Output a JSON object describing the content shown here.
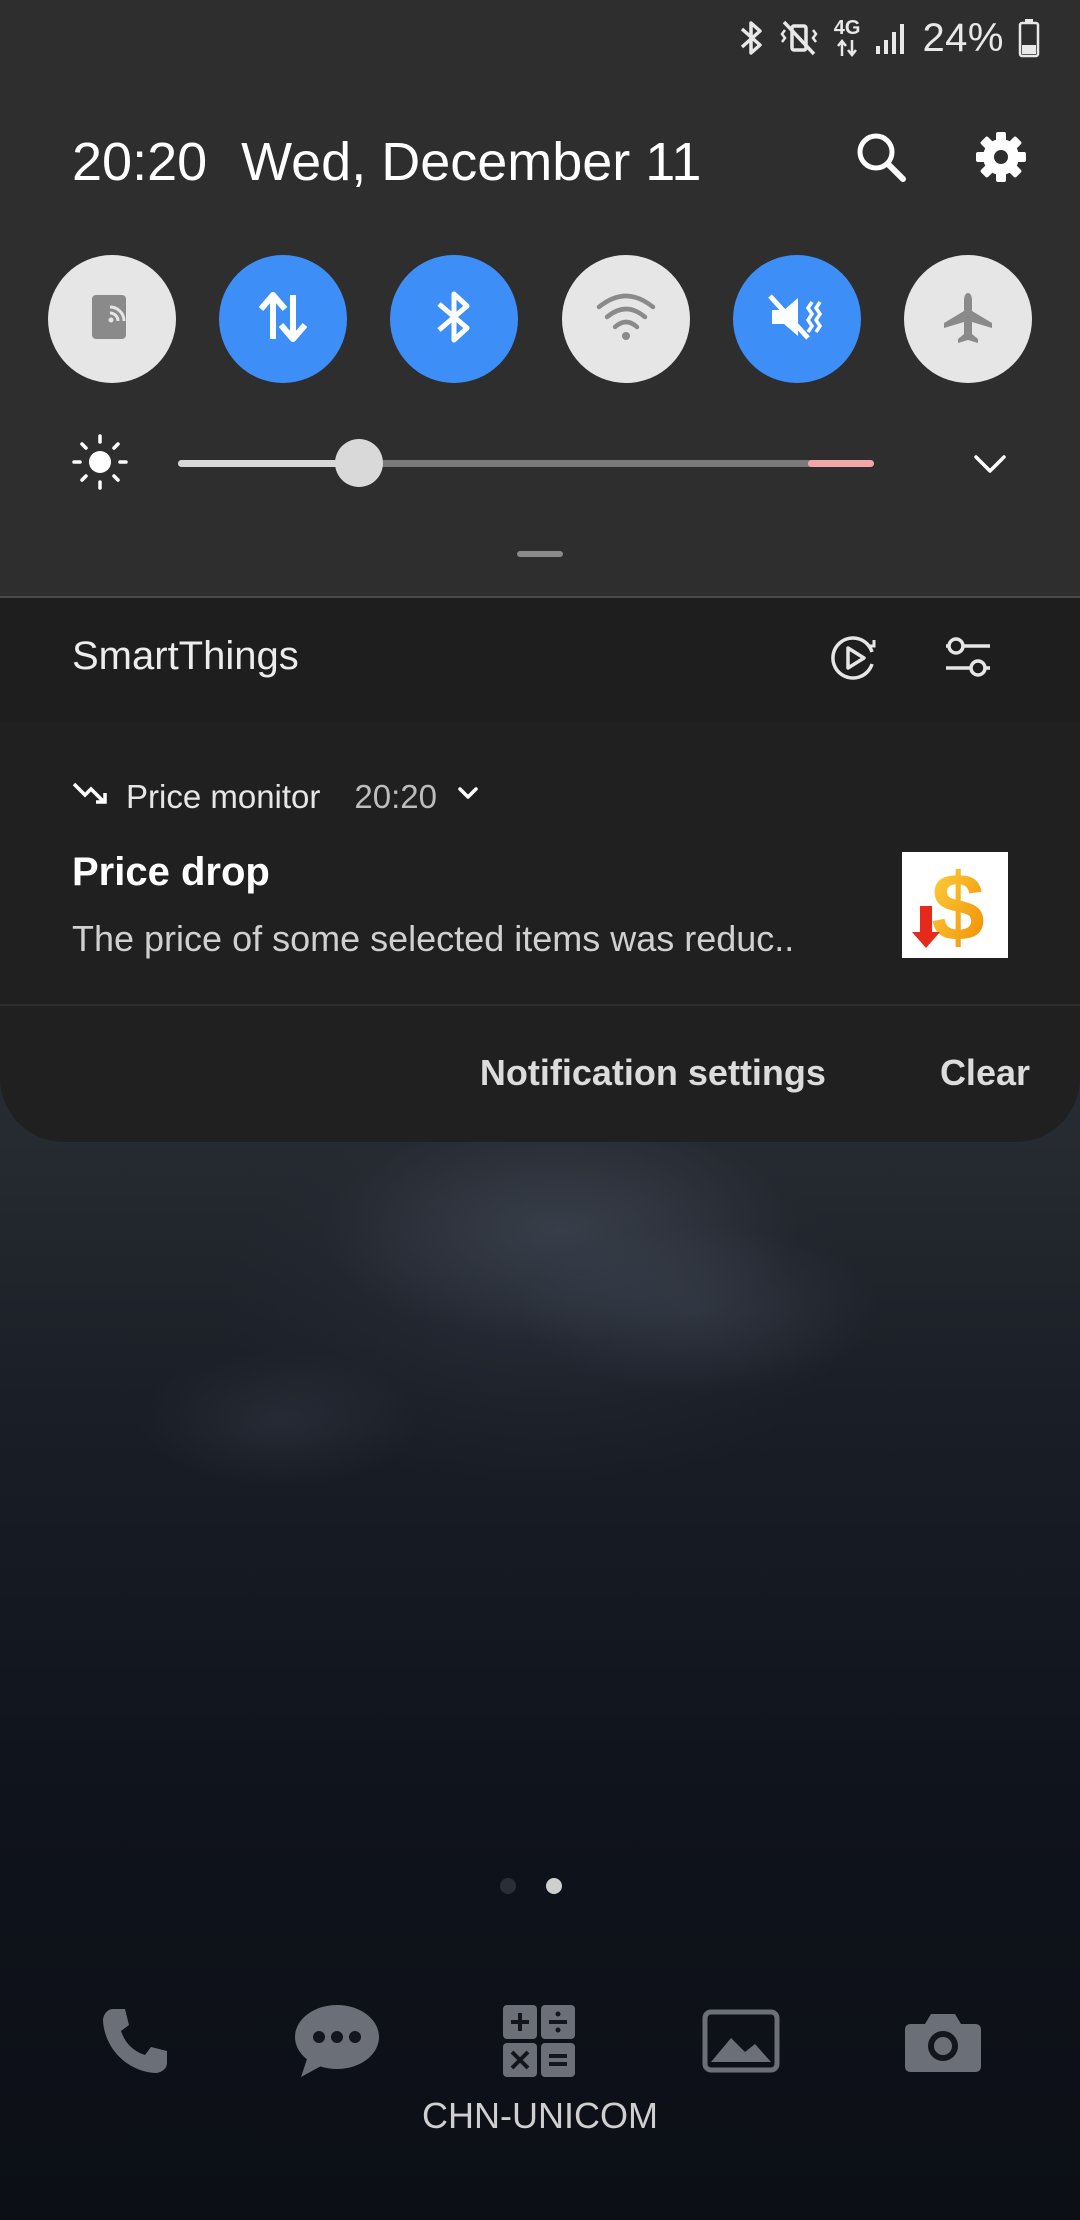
{
  "status_bar": {
    "icons": [
      "bluetooth-icon",
      "vibrate-mute-icon",
      "4g-data-icon",
      "signal-icon",
      "battery-icon"
    ],
    "network_label": "4G",
    "battery_percent": "24%"
  },
  "panel": {
    "time": "20:20",
    "date": "Wed, December 11",
    "header_icons": [
      "search-icon",
      "settings-gear-icon"
    ]
  },
  "quick_settings": [
    {
      "name": "Smart View",
      "icon": "cast-icon",
      "state": "off"
    },
    {
      "name": "Mobile data",
      "icon": "mobile-data-icon",
      "state": "on"
    },
    {
      "name": "Bluetooth",
      "icon": "bluetooth-icon",
      "state": "on"
    },
    {
      "name": "Wi-Fi",
      "icon": "wifi-icon",
      "state": "off"
    },
    {
      "name": "Sound",
      "icon": "vibrate-icon",
      "state": "on"
    },
    {
      "name": "Airplane mode",
      "icon": "airplane-icon",
      "state": "off"
    }
  ],
  "brightness": {
    "level": 0.26,
    "icon": "sun-icon"
  },
  "smart_things": {
    "label": "SmartThings",
    "icons": [
      "media-output-icon",
      "device-settings-icon"
    ]
  },
  "notification": {
    "app_name": "Price monitor",
    "time": "20:20",
    "title": "Price drop",
    "text": "The price of some selected items was reduc..",
    "settings_label": "Notification settings",
    "clear_label": "Clear"
  },
  "home": {
    "page_count": 2,
    "current_page": 2,
    "dock_apps": [
      "phone-icon",
      "messages-icon",
      "calculator-icon",
      "gallery-icon",
      "camera-icon"
    ],
    "carrier": "CHN-UNICOM"
  },
  "colors": {
    "accent": "#3e8ef7",
    "panel_bg": "#2e2e2e",
    "card_bg": "#202020"
  }
}
